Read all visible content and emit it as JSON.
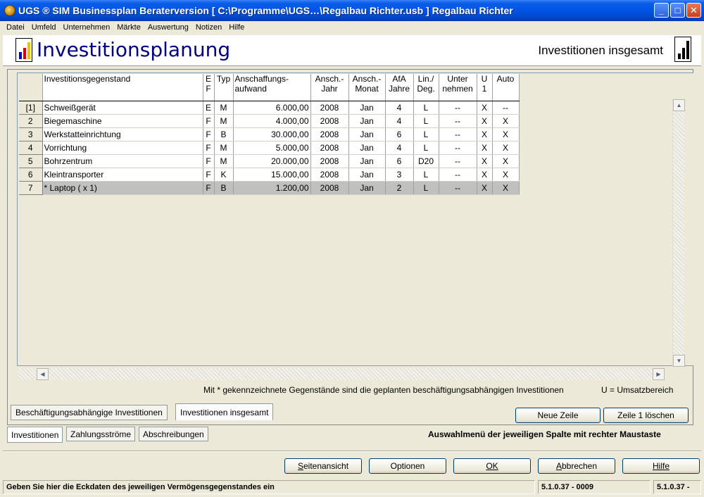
{
  "window": {
    "title": "UGS ® SIM Businessplan Beraterversion   [ C:\\Programme\\UGS…\\Regalbau Richter.usb ] Regalbau Richter",
    "minimize": "_",
    "maximize": "□",
    "close": "✕"
  },
  "menu": [
    "Datei",
    "Umfeld",
    "Unternehmen",
    "Märkte",
    "Auswertung",
    "Notizen",
    "Hilfe"
  ],
  "header": {
    "page_title": "Investitionsplanung",
    "section_title": "Investitionen insgesamt"
  },
  "grid": {
    "columns": [
      "",
      "Investitionsgegenstand",
      "E\nF",
      "Typ",
      "Anschaffungs-\naufwand",
      "Ansch.-\nJahr",
      "Ansch.-\nMonat",
      "AfA\nJahre",
      "Lin./\nDeg.",
      "Unter\nnehmen",
      "U\n1",
      "Auto"
    ],
    "rows": [
      {
        "num": "[1]",
        "name": "Schweißgerät",
        "ef": "E",
        "typ": "M",
        "aufwand": "6.000,00",
        "jahr": "2008",
        "monat": "Jan",
        "afa": "4",
        "lin": "L",
        "unter": "--",
        "u1": "X",
        "auto": "--"
      },
      {
        "num": "2",
        "name": "Biegemaschine",
        "ef": "F",
        "typ": "M",
        "aufwand": "4.000,00",
        "jahr": "2008",
        "monat": "Jan",
        "afa": "4",
        "lin": "L",
        "unter": "--",
        "u1": "X",
        "auto": "X"
      },
      {
        "num": "3",
        "name": "Werkstatteinrichtung",
        "ef": "F",
        "typ": "B",
        "aufwand": "30.000,00",
        "jahr": "2008",
        "monat": "Jan",
        "afa": "6",
        "lin": "L",
        "unter": "--",
        "u1": "X",
        "auto": "X"
      },
      {
        "num": "4",
        "name": "Vorrichtung",
        "ef": "F",
        "typ": "M",
        "aufwand": "5.000,00",
        "jahr": "2008",
        "monat": "Jan",
        "afa": "4",
        "lin": "L",
        "unter": "--",
        "u1": "X",
        "auto": "X"
      },
      {
        "num": "5",
        "name": "Bohrzentrum",
        "ef": "F",
        "typ": "M",
        "aufwand": "20.000,00",
        "jahr": "2008",
        "monat": "Jan",
        "afa": "6",
        "lin": "D20",
        "unter": "--",
        "u1": "X",
        "auto": "X"
      },
      {
        "num": "6",
        "name": "Kleintransporter",
        "ef": "F",
        "typ": "K",
        "aufwand": "15.000,00",
        "jahr": "2008",
        "monat": "Jan",
        "afa": "3",
        "lin": "L",
        "unter": "--",
        "u1": "X",
        "auto": "X"
      },
      {
        "num": "7",
        "name": "* Laptop ( x 1)",
        "ef": "F",
        "typ": "B",
        "aufwand": "1.200,00",
        "jahr": "2008",
        "monat": "Jan",
        "afa": "2",
        "lin": "L",
        "unter": "--",
        "u1": "X",
        "auto": "X"
      }
    ],
    "selected_row": 6
  },
  "note": "Mit * gekennzeichnete Gegenstände sind die geplanten beschäftigungsabhängigen Investitionen",
  "note_u": "U = Umsatzbereich",
  "subtabs": [
    "Beschäftigungsabhängige Investitionen",
    "Investitionen insgesamt"
  ],
  "row_buttons": {
    "new_row": "Neue Zeile",
    "delete_row": "Zeile 1 löschen"
  },
  "main_tabs": [
    "Investitionen",
    "Zahlungsströme",
    "Abschreibungen"
  ],
  "hint": "Auswahlmenü der jeweiligen Spalte mit rechter Maustaste",
  "dialog_buttons": {
    "page_view": "Seitenansicht",
    "options": "Optionen",
    "ok": "OK",
    "cancel": "Abbrechen",
    "help": "Hilfe"
  },
  "status": {
    "message": "Geben Sie hier die Eckdaten des jeweiligen Vermögensgegenstandes ein",
    "version1": "5.1.0.37 - 0009",
    "version2": "5.1.0.37 -"
  }
}
